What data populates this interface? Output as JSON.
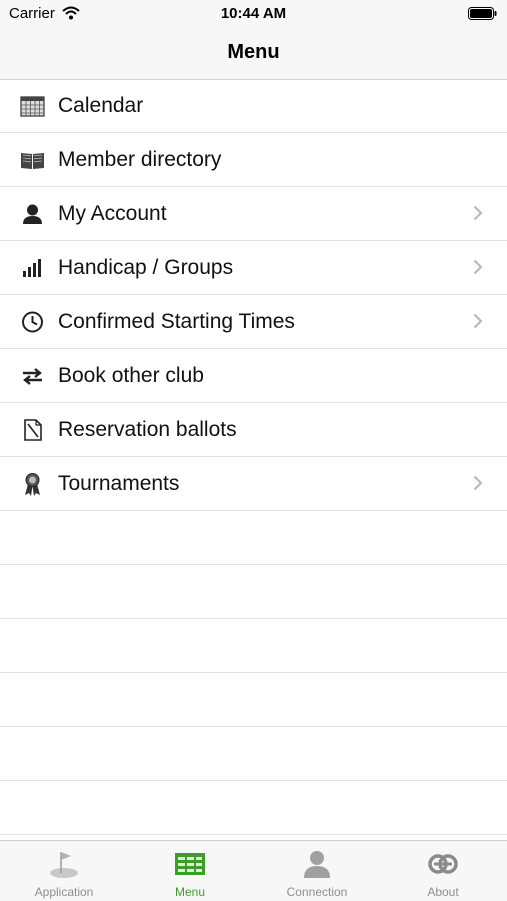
{
  "status_bar": {
    "carrier": "Carrier",
    "time": "10:44 AM"
  },
  "nav": {
    "title": "Menu"
  },
  "menu_items": [
    {
      "label": "Calendar",
      "icon": "calendar-icon",
      "has_chevron": false
    },
    {
      "label": "Member directory",
      "icon": "book-icon",
      "has_chevron": false
    },
    {
      "label": "My Account",
      "icon": "user-icon",
      "has_chevron": true
    },
    {
      "label": "Handicap / Groups",
      "icon": "bar-chart-icon",
      "has_chevron": true
    },
    {
      "label": "Confirmed Starting Times",
      "icon": "clock-icon",
      "has_chevron": true
    },
    {
      "label": "Book other club",
      "icon": "swap-arrows-icon",
      "has_chevron": false
    },
    {
      "label": "Reservation ballots",
      "icon": "ballot-icon",
      "has_chevron": false
    },
    {
      "label": "Tournaments",
      "icon": "award-ribbon-icon",
      "has_chevron": true
    }
  ],
  "tab_bar": {
    "tabs": [
      {
        "label": "Application",
        "icon": "golf-flag-icon",
        "active": false
      },
      {
        "label": "Menu",
        "icon": "menu-grid-icon",
        "active": true
      },
      {
        "label": "Connection",
        "icon": "person-icon",
        "active": false
      },
      {
        "label": "About",
        "icon": "about-logo-icon",
        "active": false
      }
    ]
  },
  "colors": {
    "accent": "#3f9b2a",
    "inactive_tab": "#8e8e8e",
    "bar_background": "#f7f7f7",
    "separator": "#e2e2e2"
  }
}
